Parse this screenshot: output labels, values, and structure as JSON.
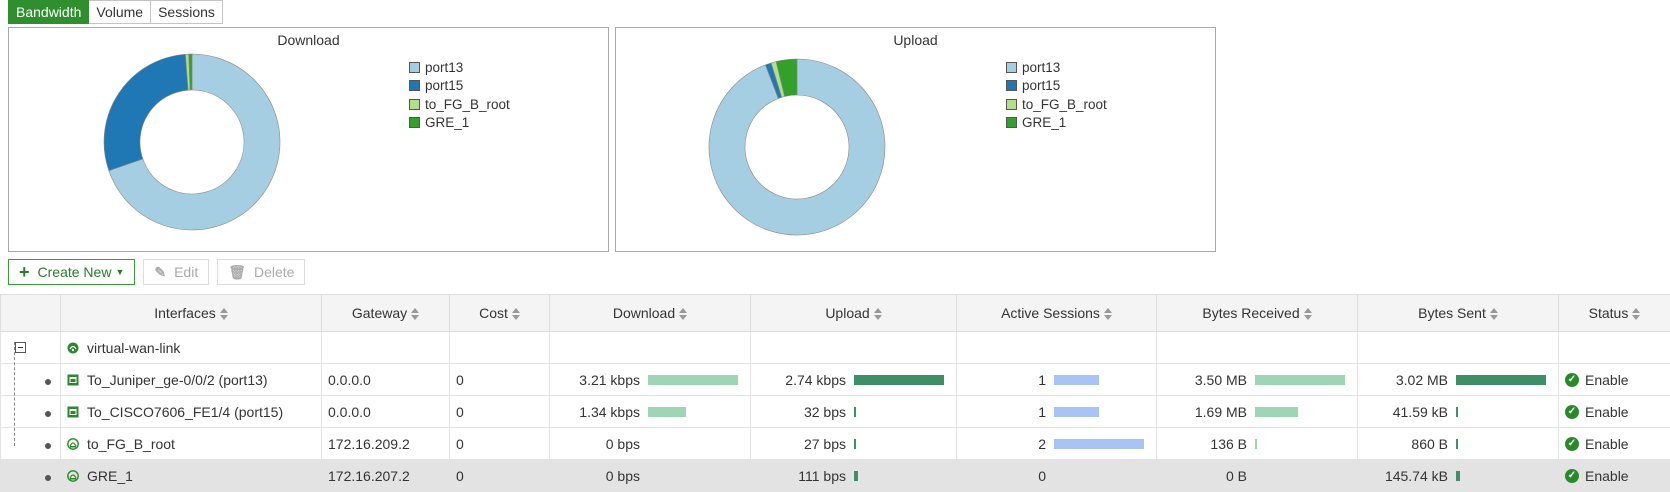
{
  "tabs": [
    {
      "label": "Bandwidth",
      "active": true
    },
    {
      "label": "Volume",
      "active": false
    },
    {
      "label": "Sessions",
      "active": false
    }
  ],
  "legend_colors": [
    "#a6cee3",
    "#1f78b4",
    "#b2df8a",
    "#33a02c"
  ],
  "chart_data": [
    {
      "type": "pie",
      "title": "Download",
      "categories": [
        "port13",
        "port15",
        "to_FG_B_root",
        "GRE_1"
      ],
      "values": [
        3.21,
        1.34,
        0,
        0
      ],
      "unit": "kbps"
    },
    {
      "type": "pie",
      "title": "Upload",
      "categories": [
        "port13",
        "port15",
        "to_FG_B_root",
        "GRE_1"
      ],
      "values": [
        2740,
        32,
        27,
        111
      ],
      "unit": "bps"
    }
  ],
  "toolbar": {
    "create_new": "Create New",
    "edit": "Edit",
    "delete": "Delete"
  },
  "table": {
    "headers": [
      "Interfaces",
      "Gateway",
      "Cost",
      "Download",
      "Upload",
      "Active Sessions",
      "Bytes Received",
      "Bytes Sent",
      "Status"
    ],
    "group": {
      "name": "virtual-wan-link"
    },
    "rows": [
      {
        "interface": "To_Juniper_ge-0/0/2 (port13)",
        "gateway": "0.0.0.0",
        "cost": "0",
        "download": "3.21 kbps",
        "download_frac": 1.0,
        "upload": "2.74 kbps",
        "upload_frac": 1.0,
        "sessions": "1",
        "sessions_frac": 0.5,
        "bytes_received": "3.50 MB",
        "bytes_received_frac": 1.0,
        "bytes_sent": "3.02 MB",
        "bytes_sent_frac": 1.0,
        "status": "Enable"
      },
      {
        "interface": "To_CISCO7606_FE1/4 (port15)",
        "gateway": "0.0.0.0",
        "cost": "0",
        "download": "1.34 kbps",
        "download_frac": 0.42,
        "upload": "32 bps",
        "upload_frac": 0.01,
        "sessions": "1",
        "sessions_frac": 0.5,
        "bytes_received": "1.69 MB",
        "bytes_received_frac": 0.48,
        "bytes_sent": "41.59 kB",
        "bytes_sent_frac": 0.01,
        "status": "Enable"
      },
      {
        "interface": "to_FG_B_root",
        "gateway": "172.16.209.2",
        "cost": "0",
        "download": "0 bps",
        "download_frac": 0,
        "upload": "27 bps",
        "upload_frac": 0.01,
        "sessions": "2",
        "sessions_frac": 1.0,
        "bytes_received": "136 B",
        "bytes_received_frac": 0.01,
        "bytes_sent": "860 B",
        "bytes_sent_frac": 0.01,
        "status": "Enable"
      },
      {
        "interface": "GRE_1",
        "gateway": "172.16.207.2",
        "cost": "0",
        "download": "0 bps",
        "download_frac": 0,
        "upload": "111 bps",
        "upload_frac": 0.04,
        "sessions": "0",
        "sessions_frac": 0,
        "bytes_received": "0 B",
        "bytes_received_frac": 0,
        "bytes_sent": "145.74 kB",
        "bytes_sent_frac": 0.04,
        "status": "Enable"
      }
    ]
  }
}
